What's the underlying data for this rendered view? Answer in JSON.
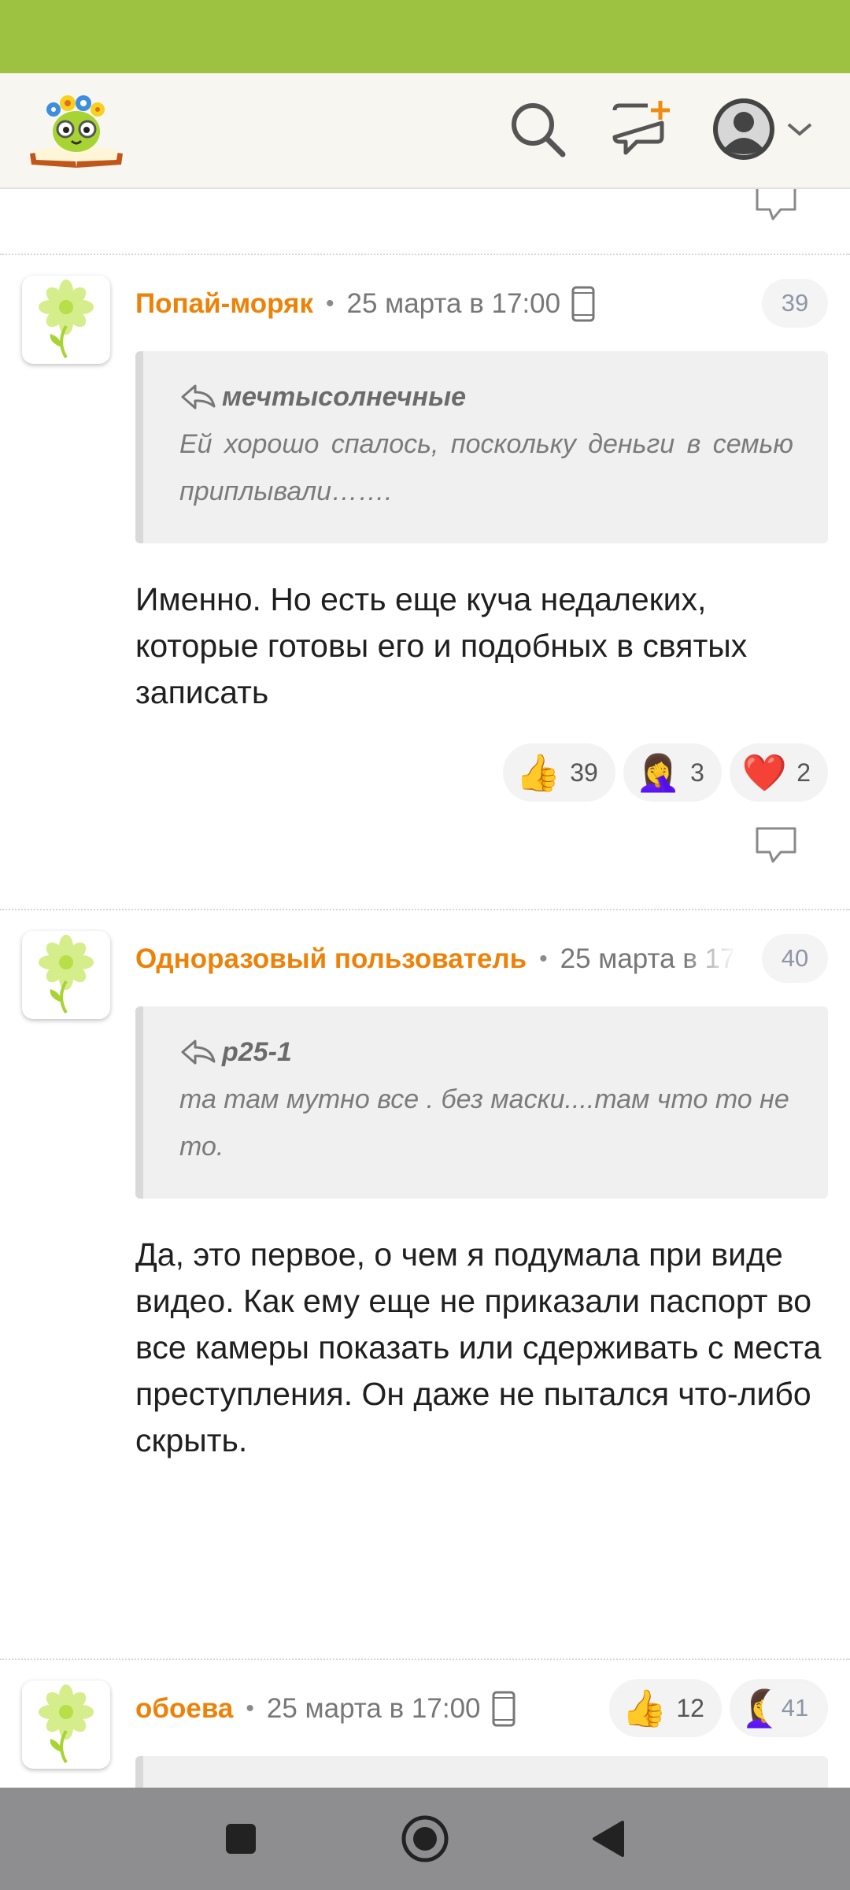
{
  "colors": {
    "status_bar": "#9dc241",
    "author": "#ee8208",
    "header_bg": "#f7f6f1",
    "nav_bar": "#8e8e90"
  },
  "header": {
    "icons": [
      "search-icon",
      "new-post-icon",
      "profile-avatar-icon",
      "chevron-down-icon"
    ]
  },
  "comments": [
    {
      "author": "Попай-моряк",
      "separator": "•",
      "date": "25 марта в 17:00",
      "device_icon": "phone-icon",
      "number": "39",
      "quote": {
        "author": "мечтысолнечные",
        "text": "Ей хорошо спалось, поскольку деньги в семью приплывали……."
      },
      "text": "Именно. Но есть еще куча недалеких, которые готовы его и подобных в святых записать",
      "reactions": [
        {
          "emoji": "👍",
          "count": "39"
        },
        {
          "emoji": "🤦‍♀️",
          "count": "3"
        },
        {
          "emoji": "❤️",
          "count": "2"
        }
      ]
    },
    {
      "author": "Одноразовый пользователь",
      "separator": "•",
      "date": "25 марта в 17",
      "number": "40",
      "quote": {
        "author": "р25-1",
        "text": "та там мутно все . без маски....там что то не то."
      },
      "text": "Да, это первое, о чем я подумала при виде видео. Как ему еще не приказали паспорт во все камеры показать или сдерживать с места преступления. Он даже не пытался что-либо скрыть.",
      "reactions": [
        {
          "emoji": "👍",
          "count": "12"
        },
        {
          "emoji": "🤦‍♀️",
          "count": "1"
        }
      ]
    },
    {
      "author": "обоева",
      "separator": "•",
      "date": "25 марта в 17:00",
      "device_icon": "phone-icon",
      "number": "41"
    }
  ],
  "nav": {
    "icons": [
      "recents-square-icon",
      "home-circle-icon",
      "back-triangle-icon"
    ]
  }
}
